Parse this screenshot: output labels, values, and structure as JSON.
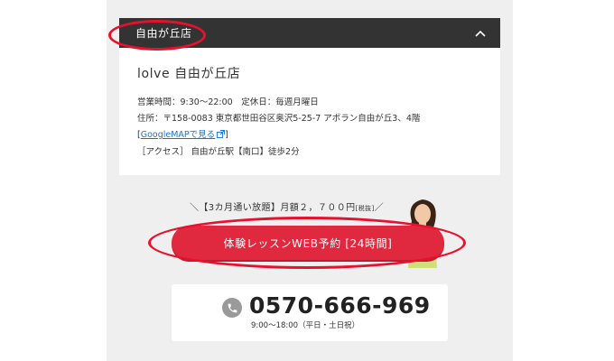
{
  "accordion": {
    "title": "自由が丘店",
    "expanded": true,
    "toggle_icon": "chevron-up-icon"
  },
  "store": {
    "name": "lolve 自由が丘店",
    "hours_line": "営業時間：9:30～22:00　定休日：毎週月曜日",
    "address_line": "住所：〒158-0083 東京都世田谷区奥沢5-25-7 アポラン自由が丘3、4階",
    "map_open": "[",
    "map_link": "GoogleMAPで見る",
    "map_close": "]",
    "access_line": "［アクセス］ 自由が丘駅【南口】徒歩2分"
  },
  "campaign": {
    "text": "＼【3カ月通い放題】月額２，７００円",
    "tax": "[税抜]",
    "suffix": "／"
  },
  "cta": {
    "label": "体験レッスンWEB予約 [24時間]"
  },
  "phone": {
    "icon": "phone-icon",
    "number": "0570-666-969",
    "hours": "9:00～18:00（平日・土日祝）"
  },
  "colors": {
    "header_bg": "#333333",
    "cta": "#e0283f",
    "annotation": "#e8112d",
    "link": "#1a73c8",
    "panel_bg": "#efefef"
  }
}
